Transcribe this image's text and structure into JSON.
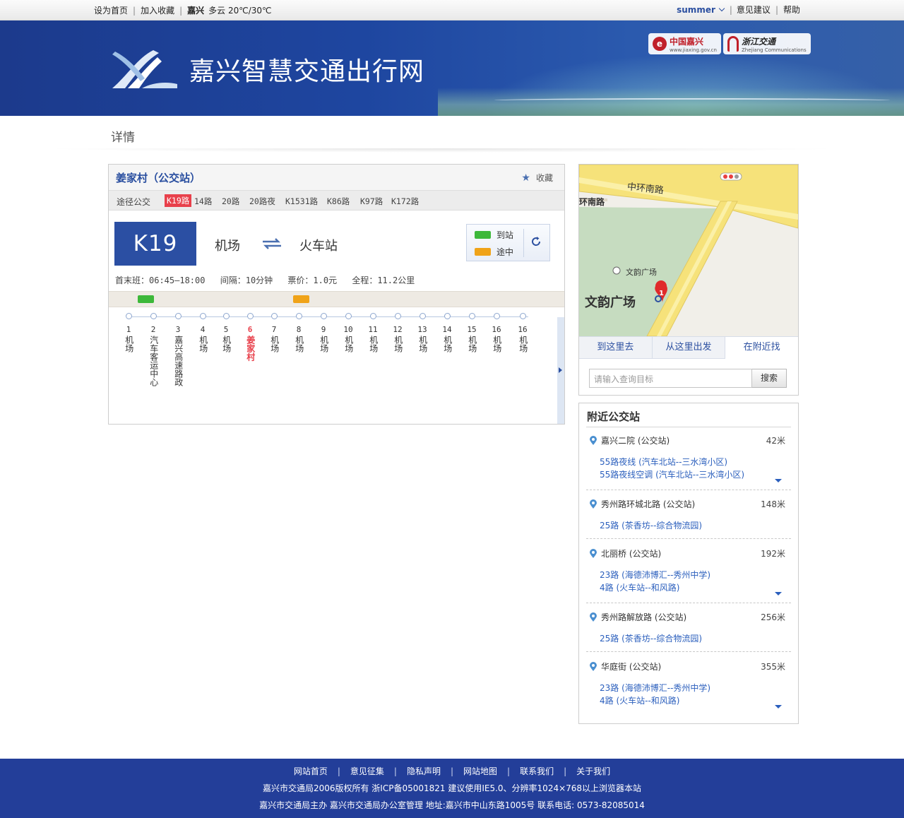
{
  "topbar": {
    "set_home": "设为首页",
    "add_fav": "加入收藏",
    "city": "嘉兴",
    "weather": "多云 20℃/30℃",
    "user": "summer",
    "feedback": "意见建议",
    "help": "帮助"
  },
  "banner": {
    "title": "嘉兴智慧交通出行网",
    "partner1": "中国嘉兴",
    "partner1_sub": "www.jiaxing.gov.cn",
    "partner2": "浙江交通",
    "partner2_sub": "Zhejiang Communications"
  },
  "section": {
    "title": "详情"
  },
  "station": {
    "name": "姜家村（公交站）",
    "fav_label": "收藏",
    "routes_label": "途径公交",
    "routes": [
      "K19路",
      "14路",
      "20路",
      "20路夜",
      "K1531路",
      "K86路",
      "K97路",
      "K172路"
    ]
  },
  "line": {
    "code": "K19",
    "from": "机场",
    "to": "火车站",
    "arrived_label": "到站",
    "enroute_label": "途中",
    "info": {
      "first_last": "首末班：06:45—18:00",
      "interval": "间隔：10分钟",
      "fare": "票价：1.0元",
      "length": "全程：11.2公里"
    },
    "stops": [
      {
        "num": "1",
        "name": "机场"
      },
      {
        "num": "2",
        "name": "汽车客运中心"
      },
      {
        "num": "3",
        "name": "嘉兴高速路政"
      },
      {
        "num": "4",
        "name": "机场"
      },
      {
        "num": "5",
        "name": "机场"
      },
      {
        "num": "6",
        "name": "姜家村"
      },
      {
        "num": "7",
        "name": "机场"
      },
      {
        "num": "8",
        "name": "机场"
      },
      {
        "num": "9",
        "name": "机场"
      },
      {
        "num": "10",
        "name": "机场"
      },
      {
        "num": "11",
        "name": "机场"
      },
      {
        "num": "12",
        "name": "机场"
      },
      {
        "num": "13",
        "name": "机场"
      },
      {
        "num": "14",
        "name": "机场"
      },
      {
        "num": "15",
        "name": "机场"
      },
      {
        "num": "16",
        "name": "机场"
      },
      {
        "num": "16",
        "name": "机场"
      }
    ],
    "current_stop_index": 5
  },
  "map": {
    "road1": "中环南路",
    "road2": "环南路",
    "poi_small": "文韵广场",
    "poi_big": "文韵广场",
    "marker": "1",
    "tabs": [
      "到这里去",
      "从这里出发",
      "在附近找"
    ],
    "search_placeholder": "请输入查询目标",
    "search_button": "搜索"
  },
  "nearby": {
    "title": "附近公交站",
    "items": [
      {
        "name": "嘉兴二院 (公交站)",
        "dist": "42米",
        "lines": [
          "55路夜线 (汽车北站--三水湾小区)",
          "55路夜线空调 (汽车北站--三水湾小区)"
        ],
        "more": true
      },
      {
        "name": "秀州路环城北路 (公交站)",
        "dist": "148米",
        "lines": [
          "25路 (茶香坊--综合物流园)"
        ],
        "more": false
      },
      {
        "name": "北丽桥 (公交站)",
        "dist": "192米",
        "lines": [
          "23路 (海德沛博汇--秀州中学)",
          "4路 (火车站--和风路)"
        ],
        "more": true
      },
      {
        "name": "秀州路解放路 (公交站)",
        "dist": "256米",
        "lines": [
          "25路 (茶香坊--综合物流园)"
        ],
        "more": false
      },
      {
        "name": "华庭街 (公交站)",
        "dist": "355米",
        "lines": [
          "23路 (海德沛博汇--秀州中学)",
          "4路 (火车站--和风路)"
        ],
        "more": true
      }
    ]
  },
  "footer": {
    "links": [
      "网站首页",
      "意见征集",
      "隐私声明",
      "网站地图",
      "联系我们",
      "关于我们"
    ],
    "copyright": "嘉兴市交通局2006版权所有 浙ICP备05001821 建议使用IE5.0、分辨率1024×768以上浏览器本站",
    "address": "嘉兴市交通局主办 嘉兴市交通局办公室管理  地址:嘉兴市中山东路1005号 联系电话: 0573-82085014"
  },
  "colors": {
    "brand_blue": "#2b4fa3",
    "highlight_red": "#e8404b",
    "bus_arrived_green": "#3db83a",
    "bus_enroute_orange": "#f0a318"
  }
}
